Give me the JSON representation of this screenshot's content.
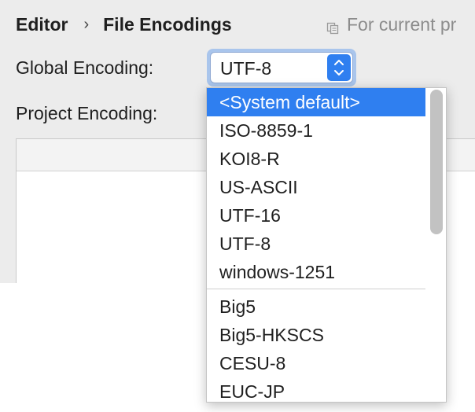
{
  "breadcrumb": {
    "parent": "Editor",
    "current": "File Encodings"
  },
  "scope_hint": {
    "text": "For current pr",
    "icon": "copy-icon"
  },
  "global_encoding": {
    "label": "Global Encoding:",
    "value": "UTF-8"
  },
  "project_encoding": {
    "label": "Project Encoding:"
  },
  "dropdown": {
    "selected": "<System default>",
    "top_options": [
      "<System default>",
      "ISO-8859-1",
      "KOI8-R",
      "US-ASCII",
      "UTF-16",
      "UTF-8",
      "windows-1251"
    ],
    "more_options": [
      "Big5",
      "Big5-HKSCS",
      "CESU-8",
      "EUC-JP"
    ]
  },
  "colors": {
    "accent": "#2f7ff0",
    "panel_bg": "#ececec",
    "hint_text": "#8c8c8c"
  }
}
